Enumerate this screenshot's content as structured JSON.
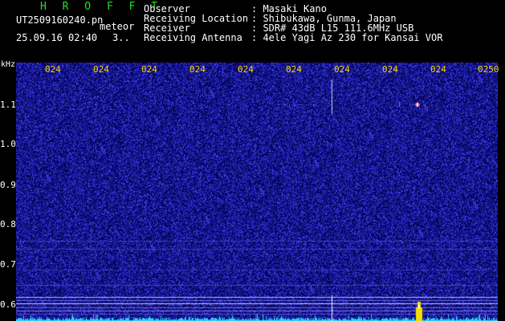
{
  "header": {
    "brand": "H R O F F T",
    "filename": "UT2509160240.pn",
    "tag": "meteor",
    "timestamp": "25.09.16 02:40",
    "counter": "3..",
    "meta": [
      {
        "key": "Observer",
        "value": ": Masaki Kano"
      },
      {
        "key": "Receiving Location",
        "value": ": Shibukawa, Gunma, Japan"
      },
      {
        "key": "Receiver",
        "value": ": SDR# 43dB L15 111.6MHz USB"
      },
      {
        "key": "Receiving Antenna",
        "value": ": 4ele Yagi Az 230 for Kansai VOR"
      }
    ]
  },
  "axis": {
    "unit": "kHz",
    "y_ticks": [
      "1.1",
      "1.0",
      "0.9",
      "0.8",
      "0.7",
      "0.6"
    ],
    "time_ticks": [
      "024",
      "024",
      "024",
      "024",
      "024",
      "024",
      "024",
      "024",
      "024",
      "0250"
    ]
  },
  "colors": {
    "background": "#000000",
    "spectrogram_base": "#0a0a78",
    "noise": "#3b3be0",
    "brand": "#22e222",
    "time_labels": "#f4d400",
    "baseline": "#2bd3f0"
  }
}
